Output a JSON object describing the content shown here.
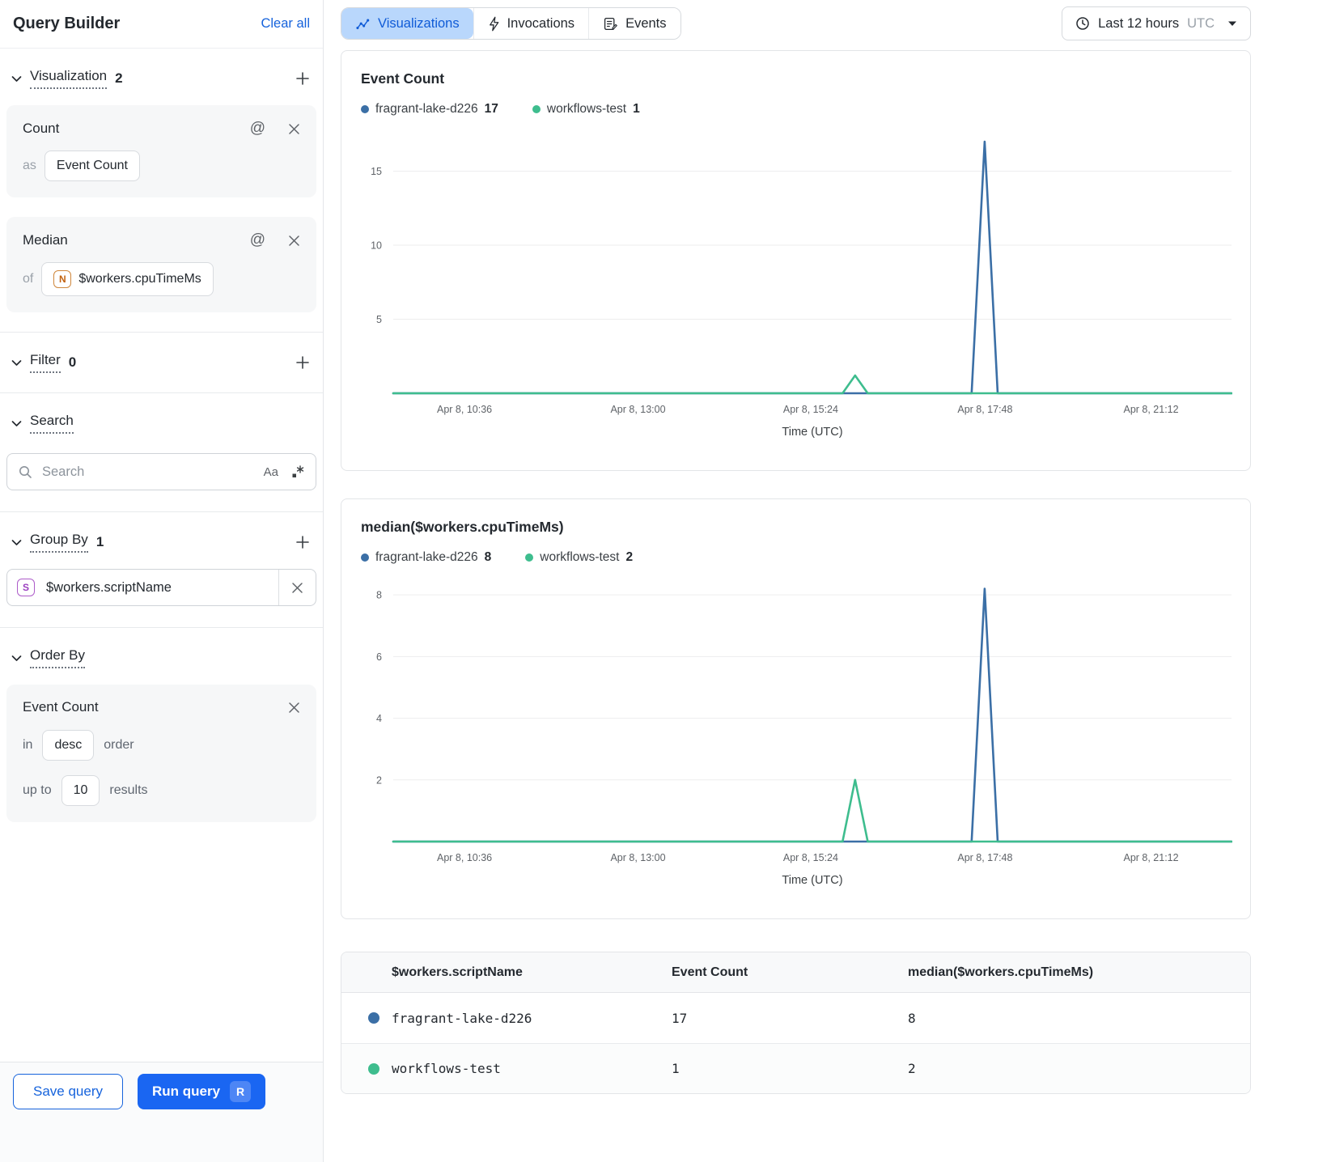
{
  "sidebar": {
    "title": "Query Builder",
    "clear_all": "Clear all",
    "visualization": {
      "label": "Visualization",
      "count": "2",
      "cards": [
        {
          "title": "Count",
          "prefix": "as",
          "value": "Event Count"
        },
        {
          "title": "Median",
          "prefix": "of",
          "value_icon": "N",
          "value": "$workers.cpuTimeMs"
        }
      ]
    },
    "filter": {
      "label": "Filter",
      "count": "0"
    },
    "search": {
      "label": "Search",
      "placeholder": "Search",
      "case_icon": "Aa"
    },
    "group_by": {
      "label": "Group By",
      "count": "1",
      "items": [
        {
          "icon": "S",
          "value": "$workers.scriptName"
        }
      ]
    },
    "order_by": {
      "label": "Order By",
      "field": "Event Count",
      "in_label": "in",
      "direction": "desc",
      "order_label": "order",
      "upto_label": "up to",
      "limit": "10",
      "results_label": "results"
    },
    "footer": {
      "save": "Save query",
      "run": "Run query",
      "run_kbd": "R"
    }
  },
  "topbar": {
    "tabs": [
      {
        "label": "Visualizations",
        "active": true
      },
      {
        "label": "Invocations",
        "active": false
      },
      {
        "label": "Events",
        "active": false
      }
    ],
    "time_range": {
      "label": "Last 12 hours",
      "tz": "UTC"
    }
  },
  "colors": {
    "accent_blue": "#1663dc",
    "run_button": "#1a66f2",
    "tab_active_bg": "#b9d7fc",
    "tab_active_text": "#0f5bd7",
    "series_blue": "#3b6fa6",
    "series_green": "#3ebd8e"
  },
  "chart_data": [
    {
      "type": "line",
      "title": "Event Count",
      "xlabel": "Time (UTC)",
      "ylim": [
        0,
        17.6
      ],
      "yticks": [
        5,
        10,
        15
      ],
      "grid": true,
      "legend_position": "top",
      "xticks": [
        {
          "pos": 0.085,
          "label": "Apr 8, 10:36"
        },
        {
          "pos": 0.292,
          "label": "Apr 8, 13:00"
        },
        {
          "pos": 0.498,
          "label": "Apr 8, 15:24"
        },
        {
          "pos": 0.706,
          "label": "Apr 8, 17:48"
        },
        {
          "pos": 0.904,
          "label": "Apr 8, 21:12"
        }
      ],
      "legend": [
        {
          "name": "fragrant-lake-d226",
          "value": "17",
          "color": "#3b6fa6"
        },
        {
          "name": "workflows-test",
          "value": "1",
          "color": "#3ebd8e"
        }
      ],
      "series": [
        {
          "name": "fragrant-lake-d226",
          "color": "#3b6fa6",
          "points": [
            [
              0,
              0
            ],
            [
              0.69,
              0
            ],
            [
              0.7055,
              17
            ],
            [
              0.721,
              0
            ],
            [
              1,
              0
            ]
          ]
        },
        {
          "name": "workflows-test",
          "color": "#3ebd8e",
          "points": [
            [
              0,
              0
            ],
            [
              0.536,
              0
            ],
            [
              0.551,
              1.2
            ],
            [
              0.566,
              0
            ],
            [
              1,
              0
            ]
          ]
        }
      ]
    },
    {
      "type": "line",
      "title": "median($workers.cpuTimeMs)",
      "xlabel": "Time (UTC)",
      "ylim": [
        0,
        8.45
      ],
      "yticks": [
        2,
        4,
        6,
        8
      ],
      "grid": true,
      "legend_position": "top",
      "xticks": [
        {
          "pos": 0.085,
          "label": "Apr 8, 10:36"
        },
        {
          "pos": 0.292,
          "label": "Apr 8, 13:00"
        },
        {
          "pos": 0.498,
          "label": "Apr 8, 15:24"
        },
        {
          "pos": 0.706,
          "label": "Apr 8, 17:48"
        },
        {
          "pos": 0.904,
          "label": "Apr 8, 21:12"
        }
      ],
      "legend": [
        {
          "name": "fragrant-lake-d226",
          "value": "8",
          "color": "#3b6fa6"
        },
        {
          "name": "workflows-test",
          "value": "2",
          "color": "#3ebd8e"
        }
      ],
      "series": [
        {
          "name": "fragrant-lake-d226",
          "color": "#3b6fa6",
          "points": [
            [
              0,
              0
            ],
            [
              0.69,
              0
            ],
            [
              0.7055,
              8.2
            ],
            [
              0.721,
              0
            ],
            [
              1,
              0
            ]
          ]
        },
        {
          "name": "workflows-test",
          "color": "#3ebd8e",
          "points": [
            [
              0,
              0
            ],
            [
              0.536,
              0
            ],
            [
              0.551,
              2
            ],
            [
              0.566,
              0
            ],
            [
              1,
              0
            ]
          ]
        }
      ]
    }
  ],
  "table": {
    "columns": [
      "$workers.scriptName",
      "Event Count",
      "median($workers.cpuTimeMs)"
    ],
    "rows": [
      {
        "color": "#3b6fa6",
        "name": "fragrant-lake-d226",
        "values": [
          "17",
          "8"
        ]
      },
      {
        "color": "#3ebd8e",
        "name": "workflows-test",
        "values": [
          "1",
          "2"
        ]
      }
    ]
  }
}
